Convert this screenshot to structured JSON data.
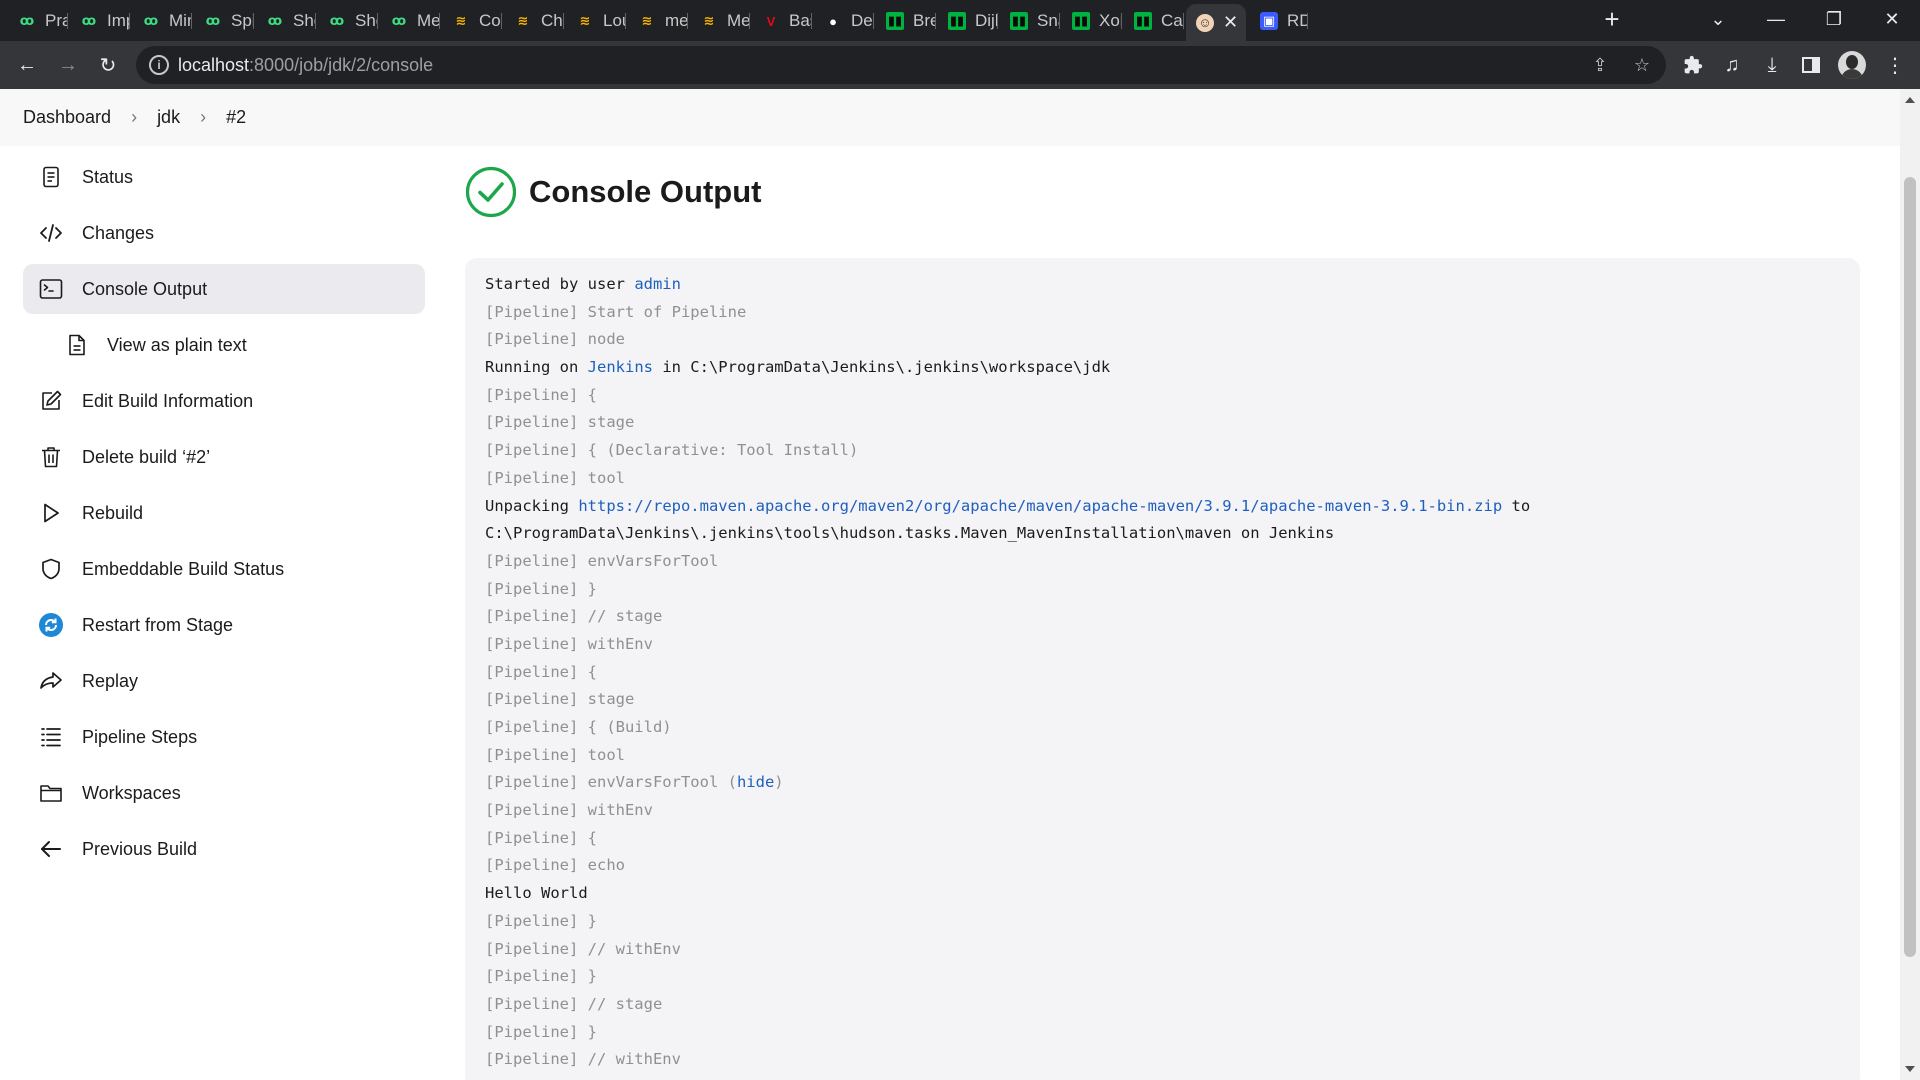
{
  "browser": {
    "tabs": [
      {
        "title": "Prac",
        "icon": "spring-leaf-icon"
      },
      {
        "title": "Imp",
        "icon": "spring-leaf-icon"
      },
      {
        "title": "Min",
        "icon": "spring-leaf-icon"
      },
      {
        "title": "Spir",
        "icon": "spring-leaf-icon"
      },
      {
        "title": "Sho",
        "icon": "spring-leaf-icon"
      },
      {
        "title": "Sho",
        "icon": "spring-leaf-icon"
      },
      {
        "title": "Me",
        "icon": "spring-leaf-icon"
      },
      {
        "title": "Cou",
        "icon": "stackoverflow-icon"
      },
      {
        "title": "Che",
        "icon": "stackoverflow-icon"
      },
      {
        "title": "Lou",
        "icon": "stackoverflow-icon"
      },
      {
        "title": "met",
        "icon": "stackoverflow-icon"
      },
      {
        "title": "Me",
        "icon": "stackoverflow-icon"
      },
      {
        "title": "Bas",
        "icon": "red-v-icon"
      },
      {
        "title": "Dev",
        "icon": "github-icon"
      },
      {
        "title": "Bre",
        "icon": "green-square-icon"
      },
      {
        "title": "Dijk",
        "icon": "green-square-icon"
      },
      {
        "title": "Sna",
        "icon": "green-square-icon"
      },
      {
        "title": "Xor",
        "icon": "green-square-icon"
      },
      {
        "title": "Can",
        "icon": "green-square-icon"
      },
      {
        "title": "",
        "icon": "jenkins-face-icon",
        "active": true
      },
      {
        "title": "RDS",
        "icon": "aws-rds-icon"
      }
    ],
    "url_host": "localhost",
    "url_path": ":8000/job/jdk/2/console",
    "colors": {
      "tabstrip": "#202124",
      "toolbar": "#35363a",
      "omnibox": "#202124"
    }
  },
  "breadcrumb": [
    "Dashboard",
    "jdk",
    "#2"
  ],
  "sidebar": {
    "items": [
      {
        "label": "Status",
        "icon": "notepad-icon"
      },
      {
        "label": "Changes",
        "icon": "code-icon"
      },
      {
        "label": "Console Output",
        "icon": "terminal-icon",
        "active": true
      },
      {
        "label": "View as plain text",
        "icon": "document-icon",
        "sub": true
      },
      {
        "label": "Edit Build Information",
        "icon": "edit-icon"
      },
      {
        "label": "Delete build ‘#2’",
        "icon": "trash-icon"
      },
      {
        "label": "Rebuild",
        "icon": "play-icon"
      },
      {
        "label": "Embeddable Build Status",
        "icon": "shield-icon"
      },
      {
        "label": "Restart from Stage",
        "icon": "restart-icon"
      },
      {
        "label": "Replay",
        "icon": "replay-arrow-icon"
      },
      {
        "label": "Pipeline Steps",
        "icon": "list-icon"
      },
      {
        "label": "Workspaces",
        "icon": "folder-icon"
      },
      {
        "label": "Previous Build",
        "icon": "arrow-left-icon"
      }
    ]
  },
  "page": {
    "title": "Console Output",
    "status_icon": "success-check-icon",
    "status_color": "#1ea64b"
  },
  "console": {
    "lines": [
      {
        "parts": [
          {
            "t": "Started by user "
          },
          {
            "t": "admin",
            "link": true
          }
        ]
      },
      {
        "pipe": true,
        "parts": [
          {
            "t": "[Pipeline] Start of Pipeline"
          }
        ]
      },
      {
        "pipe": true,
        "parts": [
          {
            "t": "[Pipeline] node"
          }
        ]
      },
      {
        "parts": [
          {
            "t": "Running on "
          },
          {
            "t": "Jenkins",
            "link": true
          },
          {
            "t": " in C:\\ProgramData\\Jenkins\\.jenkins\\workspace\\jdk"
          }
        ]
      },
      {
        "pipe": true,
        "parts": [
          {
            "t": "[Pipeline] {"
          }
        ]
      },
      {
        "pipe": true,
        "parts": [
          {
            "t": "[Pipeline] stage"
          }
        ]
      },
      {
        "pipe": true,
        "parts": [
          {
            "t": "[Pipeline] { (Declarative: Tool Install)"
          }
        ]
      },
      {
        "pipe": true,
        "parts": [
          {
            "t": "[Pipeline] tool"
          }
        ]
      },
      {
        "parts": [
          {
            "t": "Unpacking "
          },
          {
            "t": "https://repo.maven.apache.org/maven2/org/apache/maven/apache-maven/3.9.1/apache-maven-3.9.1-bin.zip",
            "link": true
          },
          {
            "t": " to"
          }
        ]
      },
      {
        "parts": [
          {
            "t": "C:\\ProgramData\\Jenkins\\.jenkins\\tools\\hudson.tasks.Maven_MavenInstallation\\maven on Jenkins"
          }
        ]
      },
      {
        "pipe": true,
        "parts": [
          {
            "t": "[Pipeline] envVarsForTool"
          }
        ]
      },
      {
        "pipe": true,
        "parts": [
          {
            "t": "[Pipeline] }"
          }
        ]
      },
      {
        "pipe": true,
        "parts": [
          {
            "t": "[Pipeline] // stage"
          }
        ]
      },
      {
        "pipe": true,
        "parts": [
          {
            "t": "[Pipeline] withEnv"
          }
        ]
      },
      {
        "pipe": true,
        "parts": [
          {
            "t": "[Pipeline] {"
          }
        ]
      },
      {
        "pipe": true,
        "parts": [
          {
            "t": "[Pipeline] stage"
          }
        ]
      },
      {
        "pipe": true,
        "parts": [
          {
            "t": "[Pipeline] { (Build)"
          }
        ]
      },
      {
        "pipe": true,
        "parts": [
          {
            "t": "[Pipeline] tool"
          }
        ]
      },
      {
        "pipe": true,
        "parts": [
          {
            "t": "[Pipeline] envVarsForTool ("
          },
          {
            "t": "hide",
            "link": true
          },
          {
            "t": ")"
          }
        ]
      },
      {
        "pipe": true,
        "parts": [
          {
            "t": "[Pipeline] withEnv"
          }
        ]
      },
      {
        "pipe": true,
        "parts": [
          {
            "t": "[Pipeline] {"
          }
        ]
      },
      {
        "pipe": true,
        "parts": [
          {
            "t": "[Pipeline] echo"
          }
        ]
      },
      {
        "parts": [
          {
            "t": "Hello World"
          }
        ]
      },
      {
        "pipe": true,
        "parts": [
          {
            "t": "[Pipeline] }"
          }
        ]
      },
      {
        "pipe": true,
        "parts": [
          {
            "t": "[Pipeline] // withEnv"
          }
        ]
      },
      {
        "pipe": true,
        "parts": [
          {
            "t": "[Pipeline] }"
          }
        ]
      },
      {
        "pipe": true,
        "parts": [
          {
            "t": "[Pipeline] // stage"
          }
        ]
      },
      {
        "pipe": true,
        "parts": [
          {
            "t": "[Pipeline] }"
          }
        ]
      },
      {
        "pipe": true,
        "parts": [
          {
            "t": "[Pipeline] // withEnv"
          }
        ]
      }
    ]
  }
}
